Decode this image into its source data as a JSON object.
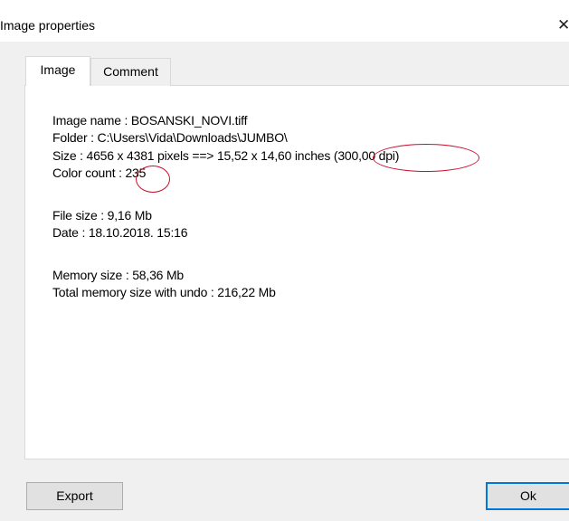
{
  "window": {
    "title": "Image properties",
    "close_glyph": "✕"
  },
  "tabs": [
    {
      "label": "Image",
      "active": true
    },
    {
      "label": "Comment",
      "active": false
    }
  ],
  "info": {
    "image_name": "Image name : BOSANSKI_NOVI.tiff",
    "folder": "Folder : C:\\Users\\Vida\\Downloads\\JUMBO\\",
    "size": "Size : 4656 x 4381 pixels ==> 15,52 x 14,60 inches (300,00 dpi)",
    "color_count": "Color count : 235",
    "file_size": "File size : 9,16 Mb",
    "date": "Date : 18.10.2018. 15:16",
    "memory_size": "Memory size : 58,36 Mb",
    "total_memory": "Total memory size with undo : 216,22 Mb"
  },
  "buttons": {
    "export": "Export",
    "ok": "Ok"
  },
  "colors": {
    "annotation_circle": "#c8102e",
    "default_button_border": "#0078d7"
  },
  "icons": {
    "close": "close-icon"
  }
}
